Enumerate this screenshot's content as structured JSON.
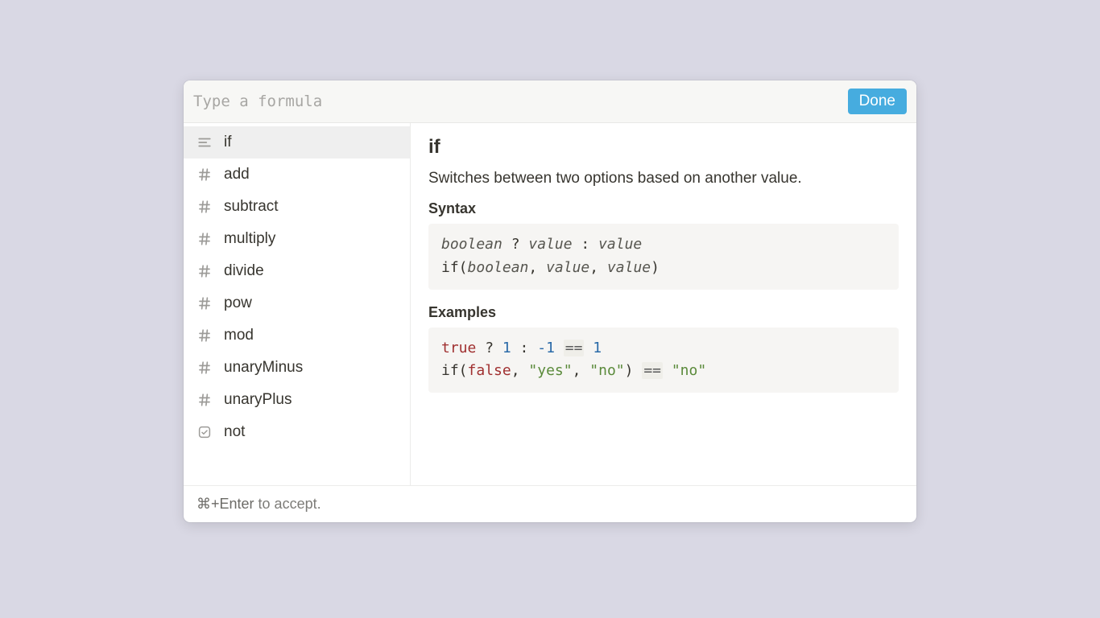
{
  "input": {
    "placeholder": "Type a formula"
  },
  "done_label": "Done",
  "functions": [
    {
      "name": "if",
      "icon": "align",
      "selected": true
    },
    {
      "name": "add",
      "icon": "hash",
      "selected": false
    },
    {
      "name": "subtract",
      "icon": "hash",
      "selected": false
    },
    {
      "name": "multiply",
      "icon": "hash",
      "selected": false
    },
    {
      "name": "divide",
      "icon": "hash",
      "selected": false
    },
    {
      "name": "pow",
      "icon": "hash",
      "selected": false
    },
    {
      "name": "mod",
      "icon": "hash",
      "selected": false
    },
    {
      "name": "unaryMinus",
      "icon": "hash",
      "selected": false
    },
    {
      "name": "unaryPlus",
      "icon": "hash",
      "selected": false
    },
    {
      "name": "not",
      "icon": "checkbox",
      "selected": false
    }
  ],
  "detail": {
    "title": "if",
    "description": "Switches between two options based on another value.",
    "syntax_label": "Syntax",
    "syntax_lines": [
      [
        {
          "t": "boolean",
          "cls": "it"
        },
        {
          "t": " ? "
        },
        {
          "t": "value",
          "cls": "it"
        },
        {
          "t": " : "
        },
        {
          "t": "value",
          "cls": "it"
        }
      ],
      [
        {
          "t": "if("
        },
        {
          "t": "boolean",
          "cls": "it"
        },
        {
          "t": ", "
        },
        {
          "t": "value",
          "cls": "it"
        },
        {
          "t": ", "
        },
        {
          "t": "value",
          "cls": "it"
        },
        {
          "t": ")"
        }
      ]
    ],
    "examples_label": "Examples",
    "example_lines": [
      [
        {
          "t": "true",
          "cls": "tok-kw"
        },
        {
          "t": " ? "
        },
        {
          "t": "1",
          "cls": "tok-num"
        },
        {
          "t": " : "
        },
        {
          "t": "-1",
          "cls": "tok-num"
        },
        {
          "t": " "
        },
        {
          "t": "==",
          "cls": "tok-op"
        },
        {
          "t": " "
        },
        {
          "t": "1",
          "cls": "tok-num"
        }
      ],
      [
        {
          "t": "if("
        },
        {
          "t": "false",
          "cls": "tok-kw"
        },
        {
          "t": ", "
        },
        {
          "t": "\"yes\"",
          "cls": "tok-str"
        },
        {
          "t": ", "
        },
        {
          "t": "\"no\"",
          "cls": "tok-str"
        },
        {
          "t": ") "
        },
        {
          "t": "==",
          "cls": "tok-op"
        },
        {
          "t": " "
        },
        {
          "t": "\"no\"",
          "cls": "tok-str"
        }
      ]
    ]
  },
  "footer": {
    "key": "⌘+Enter",
    "rest": " to accept."
  }
}
